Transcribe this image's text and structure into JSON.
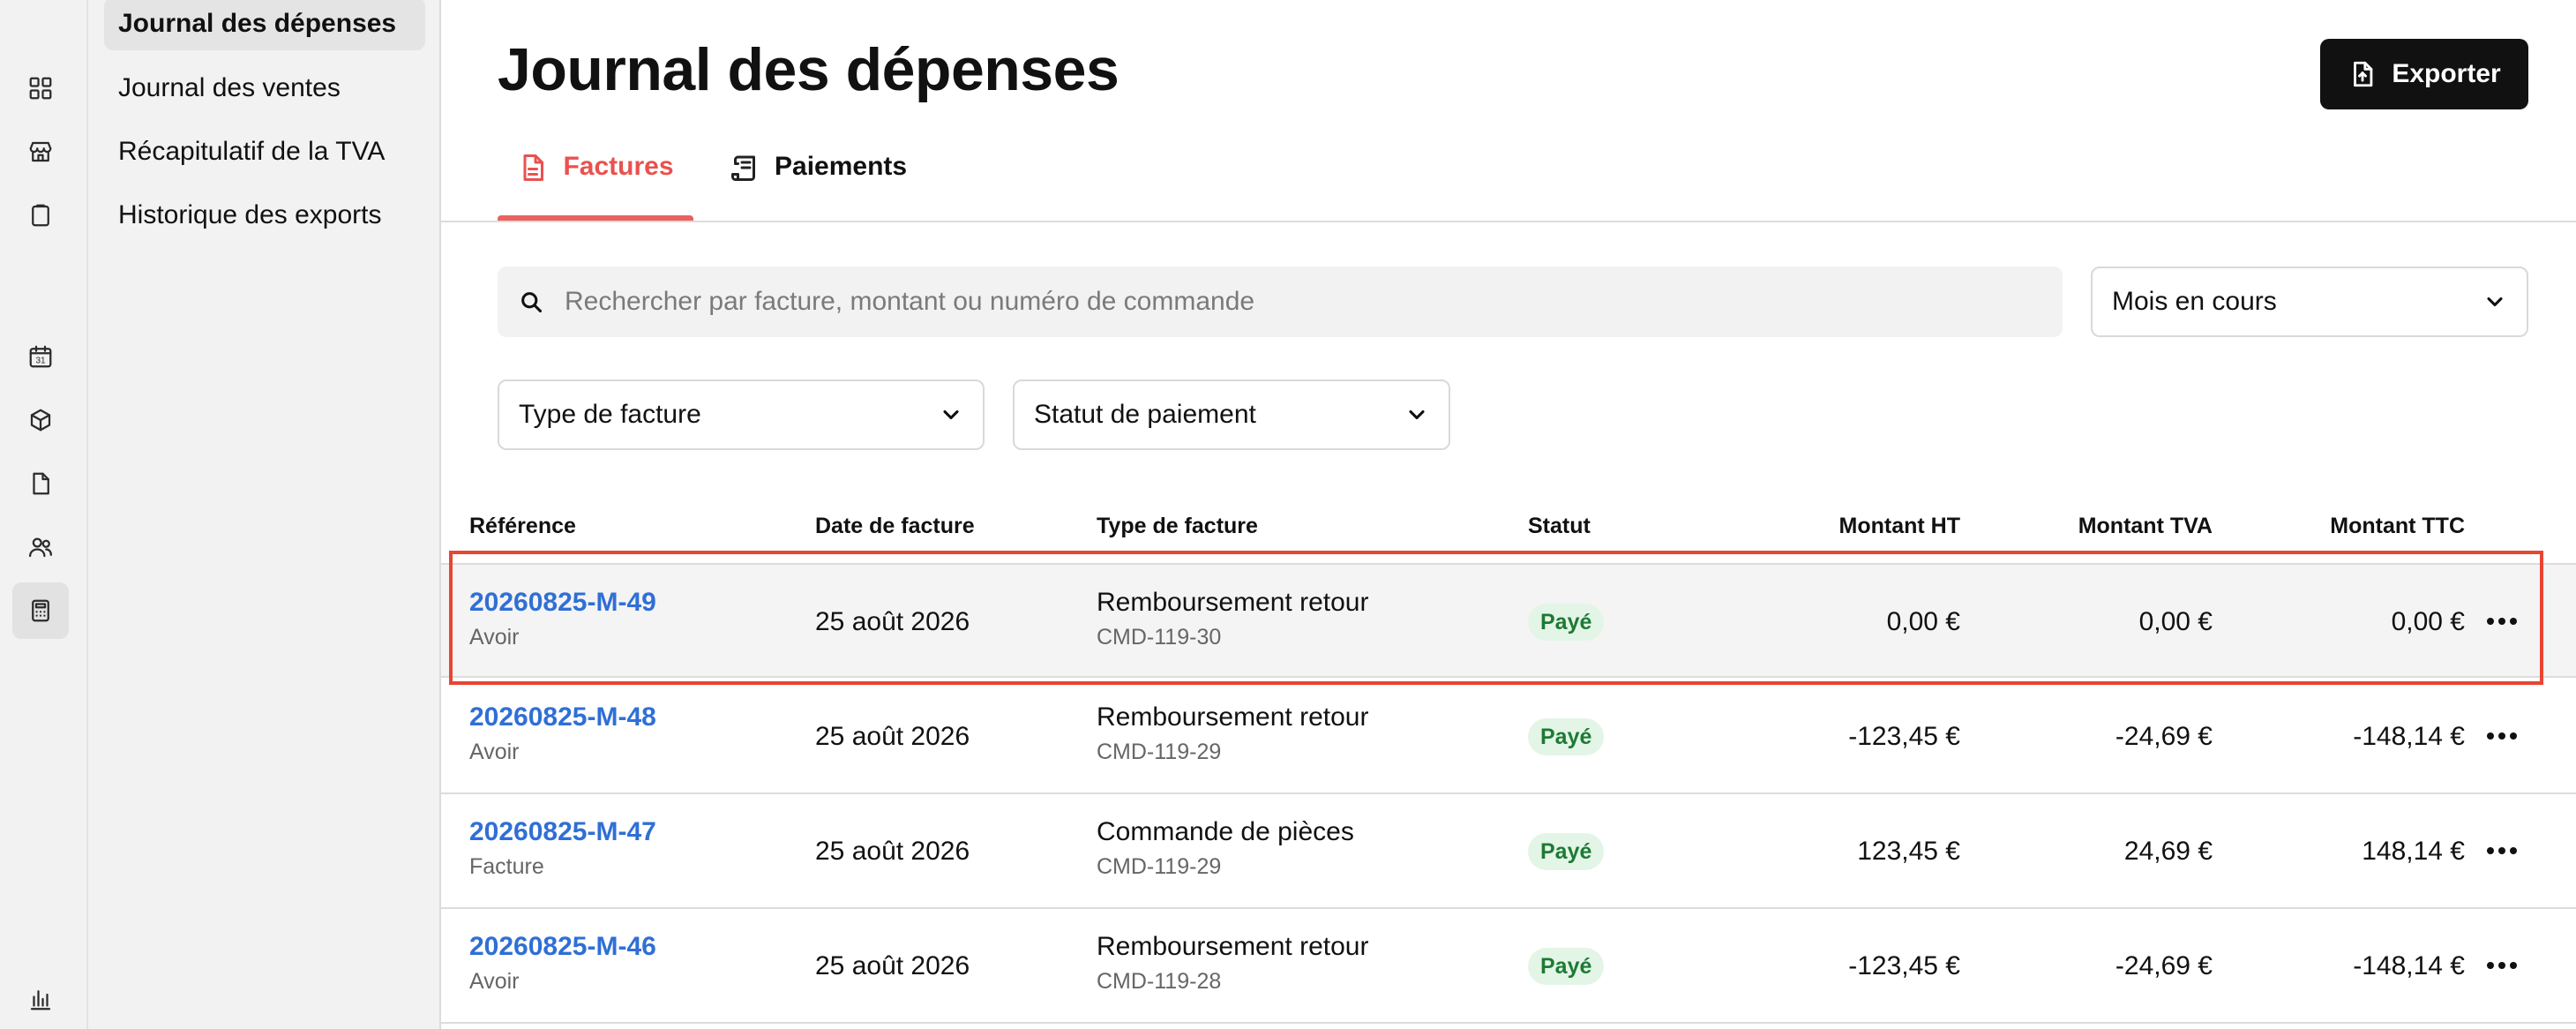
{
  "rail": {
    "icons": [
      "dashboard-icon",
      "store-icon",
      "clipboard-icon",
      "calendar-icon",
      "box-icon",
      "document-icon",
      "users-icon",
      "calculator-icon",
      "chart-icon"
    ],
    "calendar_day": "31"
  },
  "subnav": {
    "items": [
      {
        "label": "Journal des dépenses",
        "active": true
      },
      {
        "label": "Journal des ventes"
      },
      {
        "label": "Récapitulatif de la TVA"
      },
      {
        "label": "Historique des exports"
      }
    ]
  },
  "header": {
    "title": "Journal des dépenses",
    "export_label": "Exporter"
  },
  "tabs": [
    {
      "label": "Factures",
      "active": true
    },
    {
      "label": "Paiements"
    }
  ],
  "search": {
    "placeholder": "Rechercher par facture, montant ou numéro de commande"
  },
  "filters": {
    "period": "Mois en cours",
    "invoice_type": "Type de facture",
    "payment_status": "Statut de paiement"
  },
  "table": {
    "columns": [
      "Référence",
      "Date de facture",
      "Type de facture",
      "Statut",
      "Montant HT",
      "Montant TVA",
      "Montant TTC"
    ],
    "rows": [
      {
        "ref": "20260825-M-49",
        "kind": "Avoir",
        "date": "25 août 2026",
        "type": "Remboursement retour",
        "order": "CMD-119-30",
        "status": "Payé",
        "ht": "0,00 €",
        "tva": "0,00 €",
        "ttc": "0,00 €"
      },
      {
        "ref": "20260825-M-48",
        "kind": "Avoir",
        "date": "25 août 2026",
        "type": "Remboursement retour",
        "order": "CMD-119-29",
        "status": "Payé",
        "ht": "-123,45 €",
        "tva": "-24,69 €",
        "ttc": "-148,14 €"
      },
      {
        "ref": "20260825-M-47",
        "kind": "Facture",
        "date": "25 août 2026",
        "type": "Commande de pièces",
        "order": "CMD-119-29",
        "status": "Payé",
        "ht": "123,45 €",
        "tva": "24,69 €",
        "ttc": "148,14 €"
      },
      {
        "ref": "20260825-M-46",
        "kind": "Avoir",
        "date": "25 août 2026",
        "type": "Remboursement retour",
        "order": "CMD-119-28",
        "status": "Payé",
        "ht": "-123,45 €",
        "tva": "-24,69 €",
        "ttc": "-148,14 €"
      }
    ]
  },
  "colors": {
    "accent": "#e8524f",
    "link": "#2f6fd6",
    "badge_bg": "#e3f5e6",
    "badge_text": "#1d7a34",
    "highlight": "#e84533"
  }
}
